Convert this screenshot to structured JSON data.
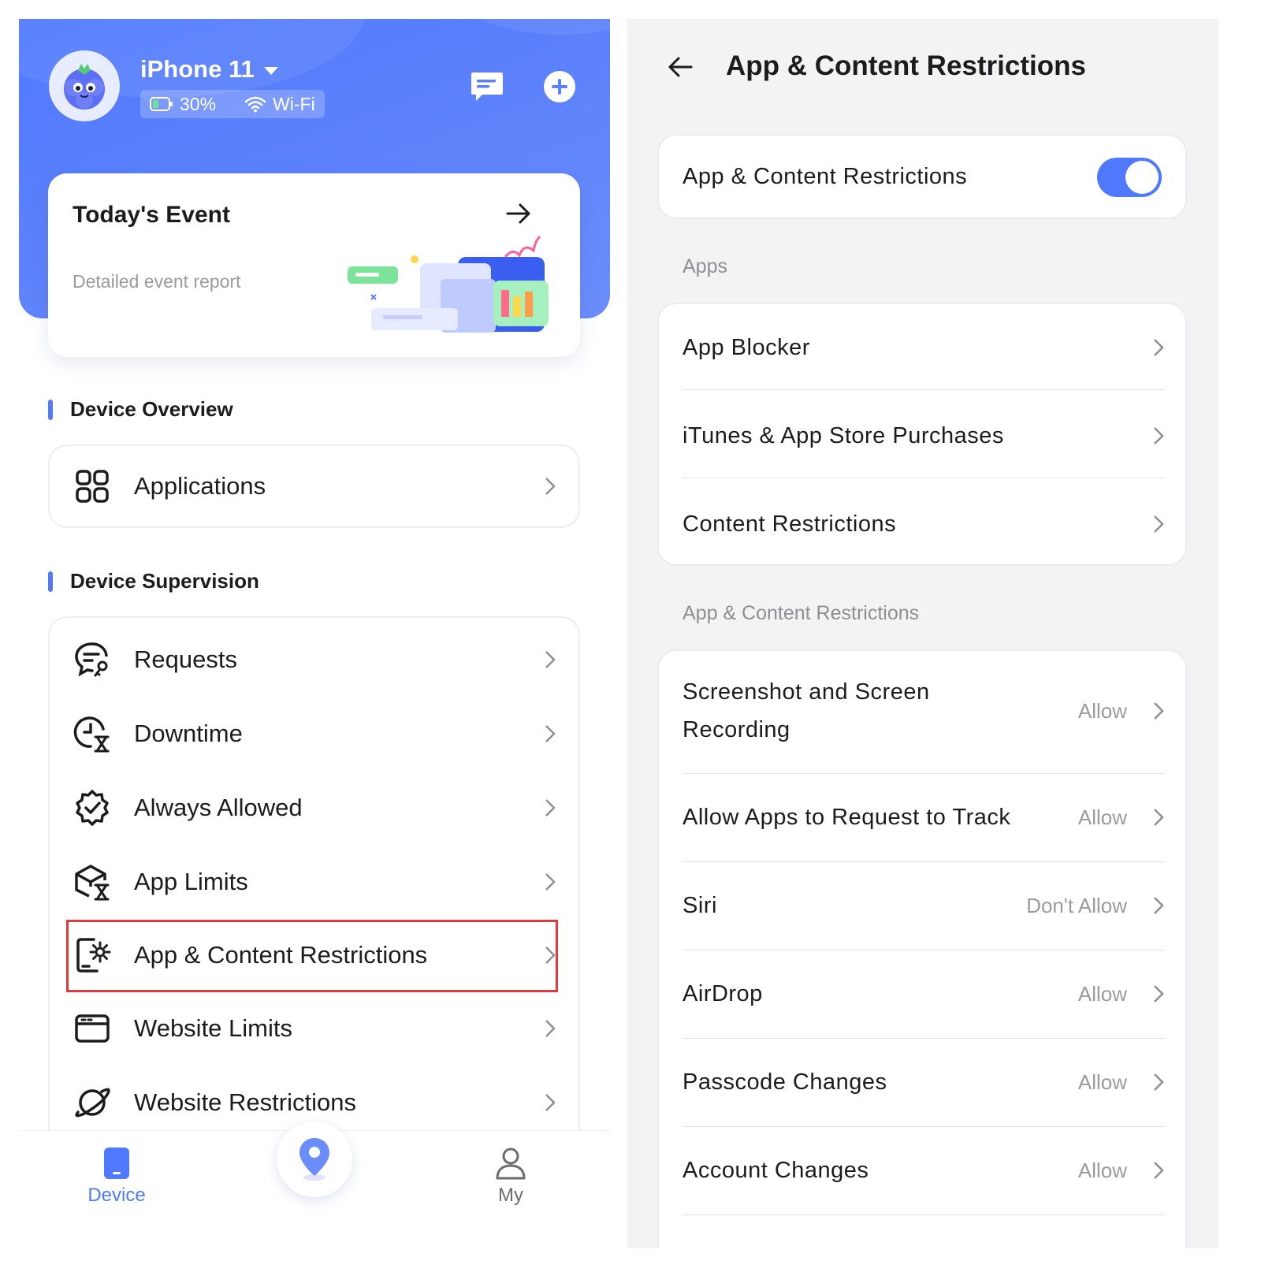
{
  "left": {
    "device": {
      "name": "iPhone 11",
      "battery": "30%",
      "network": "Wi-Fi"
    },
    "event": {
      "title": "Today's Event",
      "subtitle": "Detailed event report"
    },
    "sections": {
      "overview": "Device Overview",
      "supervision": "Device Supervision"
    },
    "overview_items": [
      {
        "label": "Applications",
        "icon": "grid-icon"
      }
    ],
    "supervision_items": [
      {
        "label": "Requests",
        "icon": "chat-key-icon"
      },
      {
        "label": "Downtime",
        "icon": "clock-hourglass-icon"
      },
      {
        "label": "Always Allowed",
        "icon": "badge-check-icon"
      },
      {
        "label": "App Limits",
        "icon": "cube-hourglass-icon"
      },
      {
        "label": "App & Content Restrictions",
        "icon": "phone-gear-icon",
        "highlighted": true
      },
      {
        "label": "Website Limits",
        "icon": "browser-window-icon"
      },
      {
        "label": "Website Restrictions",
        "icon": "planet-icon"
      }
    ],
    "tabs": [
      {
        "label": "Device",
        "active": true
      },
      {
        "label": "My",
        "active": false
      }
    ],
    "colors": {
      "accent": "#4f79ff",
      "highlight": "#e5383b"
    }
  },
  "right": {
    "title": "App & Content Restrictions",
    "master_toggle": {
      "label": "App & Content Restrictions",
      "on": true
    },
    "apps_section": "Apps",
    "apps_items": [
      {
        "label": "App Blocker"
      },
      {
        "label": "iTunes & App Store Purchases"
      },
      {
        "label": "Content Restrictions"
      }
    ],
    "restrictions_section": "App & Content Restrictions",
    "restriction_items": [
      {
        "label": "Screenshot and Screen Recording",
        "value": "Allow"
      },
      {
        "label": "Allow Apps to Request to Track",
        "value": "Allow"
      },
      {
        "label": "Siri",
        "value": "Don't Allow"
      },
      {
        "label": "AirDrop",
        "value": "Allow"
      },
      {
        "label": "Passcode Changes",
        "value": "Allow"
      },
      {
        "label": "Account Changes",
        "value": "Allow"
      }
    ]
  }
}
